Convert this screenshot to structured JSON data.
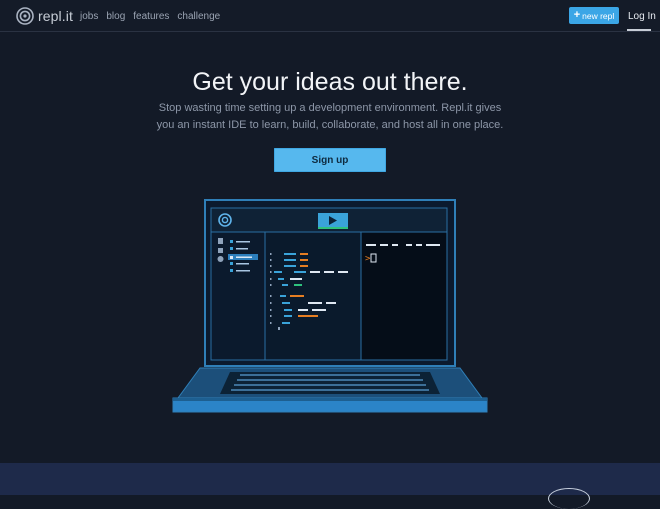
{
  "nav": {
    "logo_text": "repl.it",
    "links": [
      "jobs",
      "blog",
      "features",
      "challenge"
    ],
    "new_repl_label": "new repl",
    "login_label": "Log In"
  },
  "hero": {
    "title": "Get your ideas out there.",
    "subtitle": "Stop wasting time setting up a development environment. Repl.it gives you an instant IDE to learn, build, collaborate, and host all in one place.",
    "cta_label": "Sign up"
  },
  "colors": {
    "background": "#131a27",
    "accent": "#3ba6e6",
    "cta": "#56b8ee",
    "laptop_frame": "#2f7fb8",
    "footer_band": "#1e2a4a"
  },
  "icons": {
    "logo": "replit-spiral-icon",
    "new_repl": "plus-icon",
    "run": "play-icon",
    "files": "file-icon",
    "tree": "tree-icon",
    "settings": "gear-icon"
  }
}
